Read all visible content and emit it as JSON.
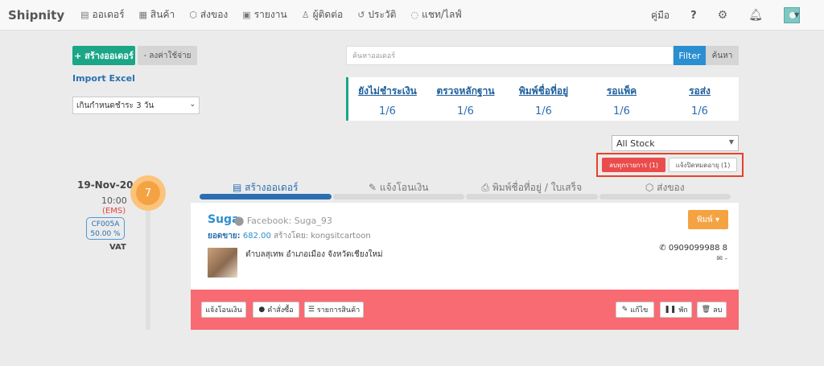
{
  "nav": {
    "brand": "Shipnity",
    "items": [
      {
        "label": "ออเดอร์",
        "icon": "order-icon"
      },
      {
        "label": "สินค้า",
        "icon": "product-icon"
      },
      {
        "label": "ส่งของ",
        "icon": "box-icon"
      },
      {
        "label": "รายงาน",
        "icon": "report-icon"
      },
      {
        "label": "ผู้ติดต่อ",
        "icon": "user-icon"
      },
      {
        "label": "ประวัติ",
        "icon": "history-icon"
      },
      {
        "label": "แชท/ไลฟ์",
        "icon": "chat-icon"
      }
    ],
    "manual": "คู่มือ",
    "help": "?"
  },
  "actions": {
    "create_order": "+ สร้างออเดอร์",
    "record_expense": "- ลงค่าใช้จ่าย",
    "import_excel": "Import Excel",
    "due_filter": "เกินกำหนดชำระ 3 วัน"
  },
  "search": {
    "placeholder": "ค้นหาออเดอร์",
    "filter_label": "Filter",
    "find_label": "ค้นหา"
  },
  "stats": [
    {
      "label": "ยังไม่ชำระเงิน",
      "value": "1/6"
    },
    {
      "label": "ตรวจหลักฐาน",
      "value": "1/6"
    },
    {
      "label": "พิมพ์ชื่อที่อยู่",
      "value": "1/6"
    },
    {
      "label": "รอแพ็ค",
      "value": "1/6"
    },
    {
      "label": "รอส่ง",
      "value": "1/6"
    }
  ],
  "stock_filter": "All Stock",
  "tags": {
    "all_items": "ลบทุกรายการ (1)",
    "expiry_notice": "แจ้งปิดหมดอายุ (1)"
  },
  "order": {
    "date": "19-Nov-20",
    "time": "10:00",
    "shipping": "(EMS)",
    "code": "CF005A",
    "rate": "50.00 %",
    "vat": "VAT",
    "number": "7",
    "steps": [
      {
        "label": "สร้างออเดอร์",
        "icon": "order-icon",
        "active": true
      },
      {
        "label": "แจ้งโอนเงิน",
        "icon": "money-icon",
        "active": false
      },
      {
        "label": "พิมพ์ชื่อที่อยู่ / ใบเสร็จ",
        "icon": "printer-icon",
        "active": false
      },
      {
        "label": "ส่งของ",
        "icon": "box-icon",
        "active": false
      }
    ],
    "customer_name": "Suga",
    "facebook": "Facebook: Suga_93",
    "sales_label": "ยอดขาย:",
    "sales_amount": "682.00",
    "created_by": "สร้างโดย: kongsitcartoon",
    "print_label": "พิมพ์",
    "phone": "0909099988 8",
    "email": "-",
    "address": "ตำบลสุเทพ อำเภอเมือง จังหวัดเชียงใหม่",
    "footer_buttons": {
      "notify_transfer": "แจ้งโอนเงิน",
      "comment": "คำสั่งซื้อ",
      "product_list": "รายการสินค้า",
      "edit": "แก้ไข",
      "pause": "พัก",
      "delete": "ลบ"
    }
  }
}
